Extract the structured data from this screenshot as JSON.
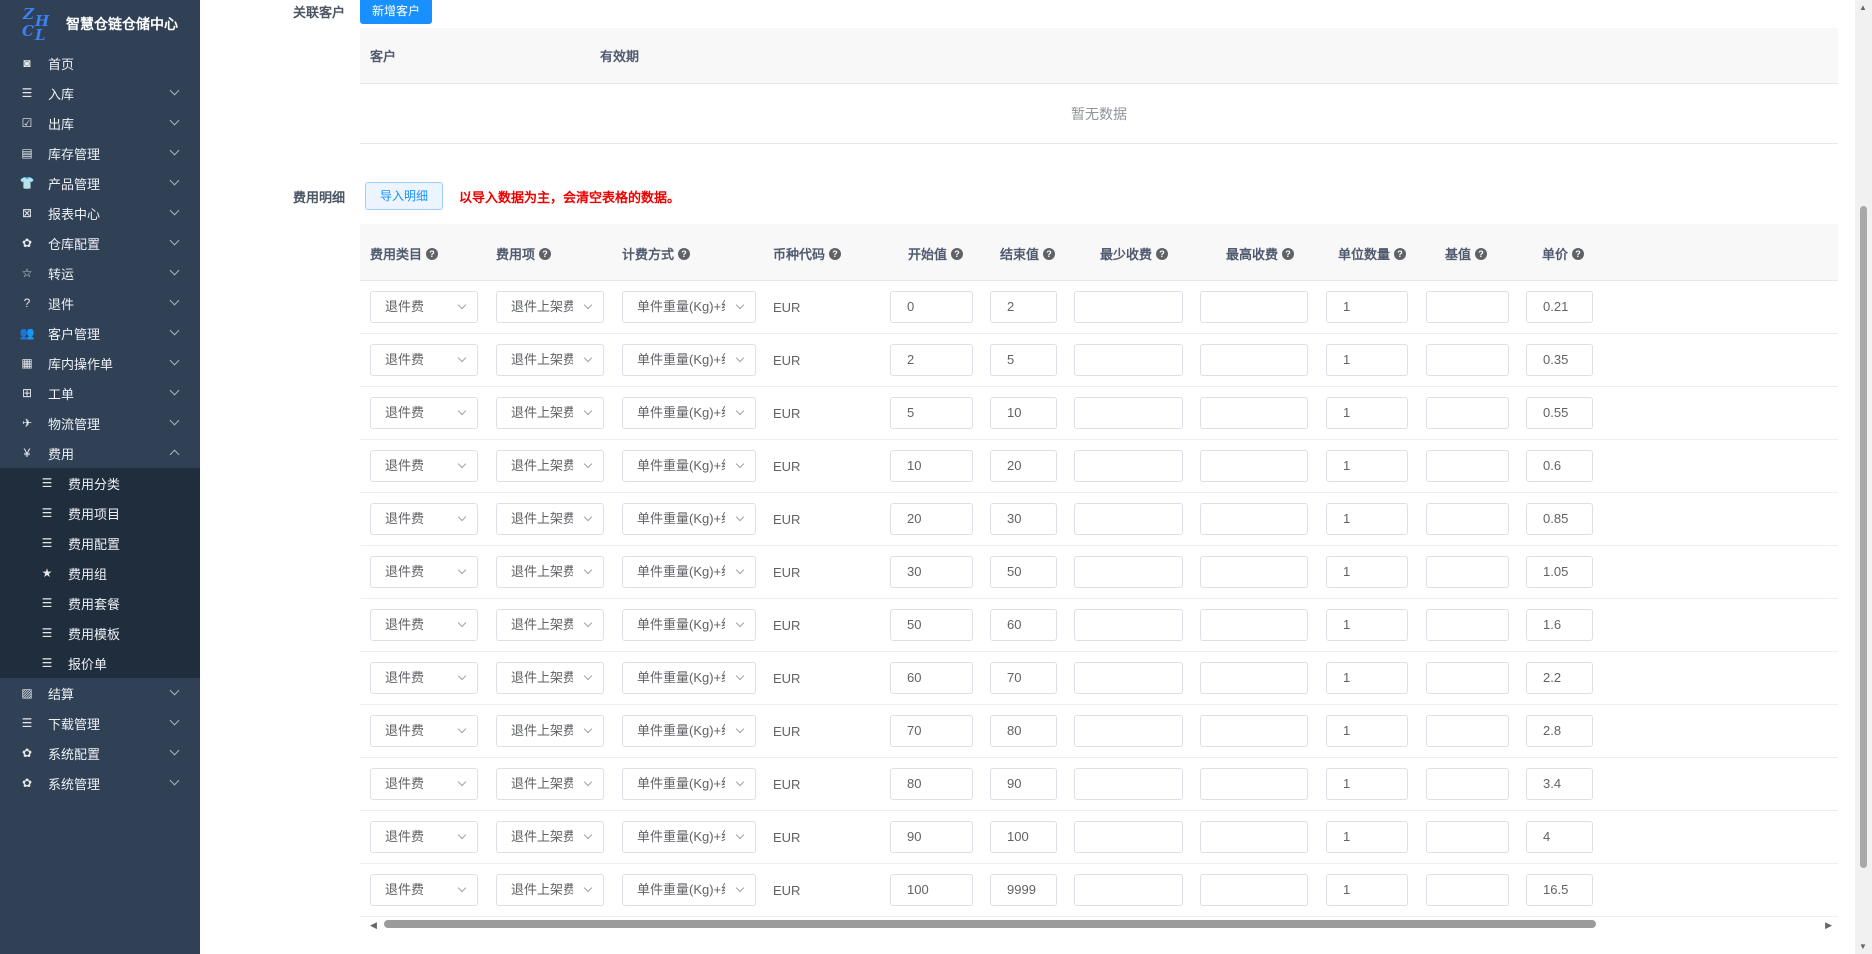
{
  "brand": {
    "logo_letters": [
      "Z",
      "H",
      "C",
      "L"
    ],
    "title": "智慧仓链仓储中心"
  },
  "sidebar": {
    "items_top": [
      {
        "label": "首页",
        "icon": "◙",
        "chev": false
      },
      {
        "label": "入库",
        "icon": "☰",
        "chev": true
      },
      {
        "label": "出库",
        "icon": "☑",
        "chev": true
      },
      {
        "label": "库存管理",
        "icon": "▤",
        "chev": true
      },
      {
        "label": "产品管理",
        "icon": "👕",
        "chev": true
      },
      {
        "label": "报表中心",
        "icon": "⊠",
        "chev": true
      },
      {
        "label": "仓库配置",
        "icon": "✿",
        "chev": true
      },
      {
        "label": "转运",
        "icon": "☆",
        "chev": true
      },
      {
        "label": "退件",
        "icon": "?",
        "chev": true
      },
      {
        "label": "客户管理",
        "icon": "👥",
        "chev": true
      },
      {
        "label": "库内操作单",
        "icon": "▦",
        "chev": true
      },
      {
        "label": "工单",
        "icon": "⊞",
        "chev": true
      },
      {
        "label": "物流管理",
        "icon": "✈",
        "chev": true
      },
      {
        "label": "费用",
        "icon": "¥",
        "chev": "up"
      }
    ],
    "submenu": [
      {
        "label": "费用分类",
        "icon": "☰"
      },
      {
        "label": "费用项目",
        "icon": "☰"
      },
      {
        "label": "费用配置",
        "icon": "☰"
      },
      {
        "label": "费用组",
        "icon": "★"
      },
      {
        "label": "费用套餐",
        "icon": "☰"
      },
      {
        "label": "费用模板",
        "icon": "☰"
      },
      {
        "label": "报价单",
        "icon": "☰"
      }
    ],
    "items_bottom": [
      {
        "label": "结算",
        "icon": "▨"
      },
      {
        "label": "下载管理",
        "icon": "☰"
      },
      {
        "label": "系统配置",
        "icon": "✿"
      },
      {
        "label": "系统管理",
        "icon": "✿"
      }
    ]
  },
  "customer_section": {
    "label": "关联客户",
    "add_button": "新增客户",
    "columns": [
      "客户",
      "有效期"
    ],
    "empty_text": "暂无数据"
  },
  "fee_section": {
    "label": "费用明细",
    "import_button": "导入明细",
    "warning": "以导入数据为主，会清空表格的数据。",
    "columns": [
      "费用类目",
      "费用项",
      "计费方式",
      "币种代码",
      "开始值",
      "结束值",
      "最少收费",
      "最高收费",
      "单位数量",
      "基值",
      "单价"
    ],
    "rows": [
      {
        "category": "退件费",
        "item": "退件上架费",
        "method": "单件重量(Kg)+续重[",
        "currency": "EUR",
        "start": "0",
        "end": "2",
        "min": "",
        "max": "",
        "qty": "1",
        "base": "",
        "price": "0.21"
      },
      {
        "category": "退件费",
        "item": "退件上架费",
        "method": "单件重量(Kg)+续重[",
        "currency": "EUR",
        "start": "2",
        "end": "5",
        "min": "",
        "max": "",
        "qty": "1",
        "base": "",
        "price": "0.35"
      },
      {
        "category": "退件费",
        "item": "退件上架费",
        "method": "单件重量(Kg)+续重[",
        "currency": "EUR",
        "start": "5",
        "end": "10",
        "min": "",
        "max": "",
        "qty": "1",
        "base": "",
        "price": "0.55"
      },
      {
        "category": "退件费",
        "item": "退件上架费",
        "method": "单件重量(Kg)+续重[",
        "currency": "EUR",
        "start": "10",
        "end": "20",
        "min": "",
        "max": "",
        "qty": "1",
        "base": "",
        "price": "0.6"
      },
      {
        "category": "退件费",
        "item": "退件上架费",
        "method": "单件重量(Kg)+续重[",
        "currency": "EUR",
        "start": "20",
        "end": "30",
        "min": "",
        "max": "",
        "qty": "1",
        "base": "",
        "price": "0.85"
      },
      {
        "category": "退件费",
        "item": "退件上架费",
        "method": "单件重量(Kg)+续重[",
        "currency": "EUR",
        "start": "30",
        "end": "50",
        "min": "",
        "max": "",
        "qty": "1",
        "base": "",
        "price": "1.05"
      },
      {
        "category": "退件费",
        "item": "退件上架费",
        "method": "单件重量(Kg)+续重[",
        "currency": "EUR",
        "start": "50",
        "end": "60",
        "min": "",
        "max": "",
        "qty": "1",
        "base": "",
        "price": "1.6"
      },
      {
        "category": "退件费",
        "item": "退件上架费",
        "method": "单件重量(Kg)+续重[",
        "currency": "EUR",
        "start": "60",
        "end": "70",
        "min": "",
        "max": "",
        "qty": "1",
        "base": "",
        "price": "2.2"
      },
      {
        "category": "退件费",
        "item": "退件上架费",
        "method": "单件重量(Kg)+续重[",
        "currency": "EUR",
        "start": "70",
        "end": "80",
        "min": "",
        "max": "",
        "qty": "1",
        "base": "",
        "price": "2.8"
      },
      {
        "category": "退件费",
        "item": "退件上架费",
        "method": "单件重量(Kg)+续重[",
        "currency": "EUR",
        "start": "80",
        "end": "90",
        "min": "",
        "max": "",
        "qty": "1",
        "base": "",
        "price": "3.4"
      },
      {
        "category": "退件费",
        "item": "退件上架费",
        "method": "单件重量(Kg)+续重[",
        "currency": "EUR",
        "start": "90",
        "end": "100",
        "min": "",
        "max": "",
        "qty": "1",
        "base": "",
        "price": "4"
      },
      {
        "category": "退件费",
        "item": "退件上架费",
        "method": "单件重量(Kg)+续重[",
        "currency": "EUR",
        "start": "100",
        "end": "9999",
        "min": "",
        "max": "",
        "qty": "1",
        "base": "",
        "price": "16.5"
      }
    ]
  }
}
